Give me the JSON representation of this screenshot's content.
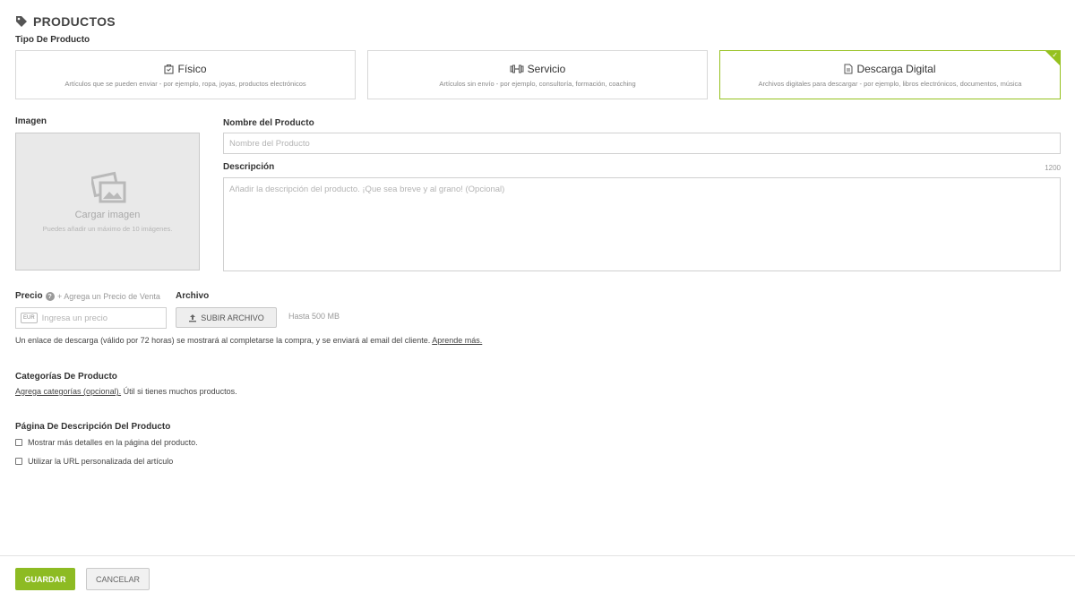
{
  "header": {
    "title": "PRODUCTOS",
    "icon": "tag-icon"
  },
  "product_type": {
    "label": "Tipo De Producto",
    "accent_color": "#95c11f",
    "options": [
      {
        "title": "Físico",
        "description": "Artículos que se pueden enviar - por ejemplo, ropa, joyas, productos electrónicos",
        "icon": "package-icon",
        "selected": false
      },
      {
        "title": "Servicio",
        "description": "Artículos sin envío - por ejemplo, consultoría, formación, coaching",
        "icon": "dumbbell-icon",
        "selected": false
      },
      {
        "title": "Descarga Digital",
        "description": "Archivos digitales para descargar - por ejemplo, libros electrónicos, documentos, música",
        "icon": "document-icon",
        "selected": true
      }
    ]
  },
  "image": {
    "label": "Imagen",
    "upload_title": "Cargar imagen",
    "upload_hint": "Puedes añadir un máximo de 10 imágenes."
  },
  "name": {
    "label": "Nombre del Producto",
    "placeholder": "Nombre del Producto",
    "value": ""
  },
  "description": {
    "label": "Descripción",
    "max_chars": "1200",
    "placeholder": "Añadir la descripción del producto. ¡Que sea breve y al grano! (Opcional)",
    "value": ""
  },
  "price": {
    "label": "Precio",
    "add_sale_price": "+ Agrega un Precio de Venta",
    "currency": "EUR",
    "placeholder": "Ingresa un precio",
    "value": ""
  },
  "file": {
    "label": "Archivo",
    "upload_button": "SUBIR ARCHIVO",
    "limit": "Hasta 500 MB"
  },
  "download_note": {
    "text": "Un enlace de descarga (válido por 72 horas) se mostrará al completarse la compra, y se enviará al email del cliente.",
    "link": "Aprende más."
  },
  "categories": {
    "label": "Categorías De Producto",
    "link": "Agrega categorías (opcional).",
    "text": "Útil si tienes muchos productos."
  },
  "product_page": {
    "label": "Página De Descripción Del Producto",
    "options": [
      {
        "label": "Mostrar más detalles en la página del producto.",
        "checked": false
      },
      {
        "label": "Utilizar la URL personalizada del artículo",
        "checked": false
      }
    ]
  },
  "actions": {
    "save": "GUARDAR",
    "cancel": "CANCELAR",
    "save_color": "#8dbb23"
  }
}
